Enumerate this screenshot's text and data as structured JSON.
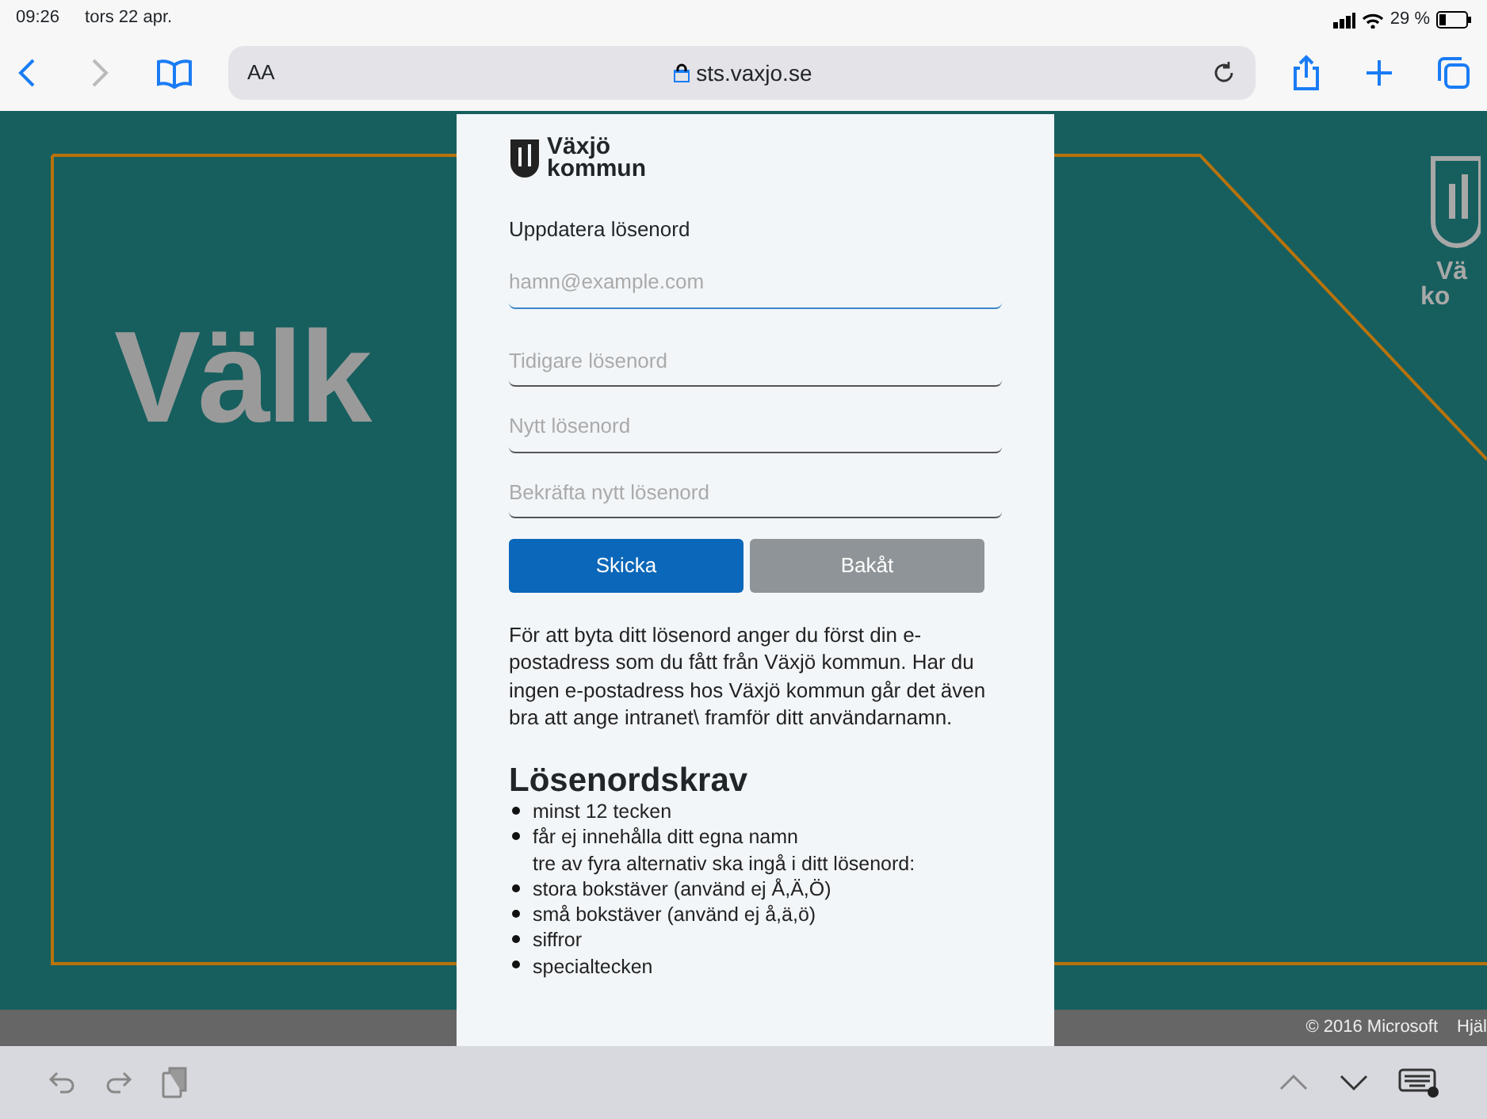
{
  "status_bar": {
    "time": "09:26",
    "date": "tors 22 apr.",
    "battery": "29 %"
  },
  "browser_toolbar": {
    "text_size": "AA",
    "url": "sts.vaxjo.se"
  },
  "background": {
    "hero_text": "Välk",
    "logo_lines": [
      "Vä",
      "ko"
    ]
  },
  "panel": {
    "logo_lines": [
      "Växjö",
      "kommun"
    ],
    "title": "Uppdatera lösenord",
    "fields": [
      {
        "placeholder": "hamn@example.com",
        "focused": true
      },
      {
        "placeholder": "Tidigare lösenord",
        "focused": false
      },
      {
        "placeholder": "Nytt lösenord",
        "focused": false
      },
      {
        "placeholder": "Bekräfta nytt lösenord",
        "focused": false
      }
    ],
    "buttons": [
      {
        "label": "Skicka",
        "disabled": false
      },
      {
        "label": "Bakåt",
        "disabled": true
      }
    ],
    "info": "För att byta ditt lösenord anger du först din e-postadress som du fått från Växjö kommun. Har du ingen e-postadress hos Växjö kommun går det även bra att ange intranet\\ framför ditt användarnamn.",
    "requirements_title": "Lösenordskrav",
    "requirements": [
      {
        "kind": "bullet",
        "text": "minst 12 tecken"
      },
      {
        "kind": "bullet",
        "text": "får ej innehålla ditt egna namn"
      },
      {
        "kind": "note",
        "text": "tre av fyra alternativ ska ingå i ditt lösenord:"
      },
      {
        "kind": "bullet",
        "text": "stora bokstäver (använd ej Å,Ä,Ö)"
      },
      {
        "kind": "bullet",
        "text": "små bokstäver (använd ej å,ä,ö)"
      },
      {
        "kind": "bullet",
        "text": "siffror"
      },
      {
        "kind": "bullet",
        "text": "specialtecken"
      }
    ]
  },
  "footer": {
    "copyright": "© 2016 Microsoft",
    "link": "Hjäl"
  }
}
